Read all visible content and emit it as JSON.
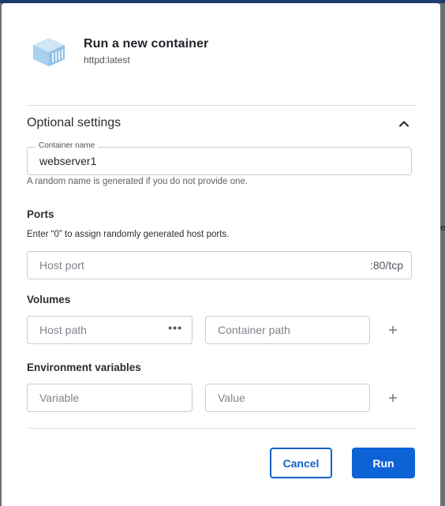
{
  "dialog": {
    "title": "Run a new container",
    "image": "httpd:latest",
    "icon": "container-icon"
  },
  "optional_settings": {
    "title": "Optional settings",
    "expanded": true,
    "toggle_icon": "chevron-up-icon"
  },
  "container_name": {
    "label": "Container name",
    "value": "webserver1",
    "helper": "A random name is generated if you do not provide one."
  },
  "ports": {
    "label": "Ports",
    "hint": "Enter “0” to assign randomly generated host ports.",
    "host_port_placeholder": "Host port",
    "container_port": ":80/tcp"
  },
  "volumes": {
    "label": "Volumes",
    "host_path_placeholder": "Host path",
    "browse_icon": "more-horizontal-icon",
    "container_path_placeholder": "Container path",
    "add_icon": "plus-icon"
  },
  "environment": {
    "label": "Environment variables",
    "variable_placeholder": "Variable",
    "value_placeholder": "Value",
    "add_icon": "plus-icon"
  },
  "actions": {
    "cancel": "Cancel",
    "run": "Run"
  },
  "colors": {
    "primary": "#0d63d6",
    "icon_blue": "#a9d1ee"
  }
}
